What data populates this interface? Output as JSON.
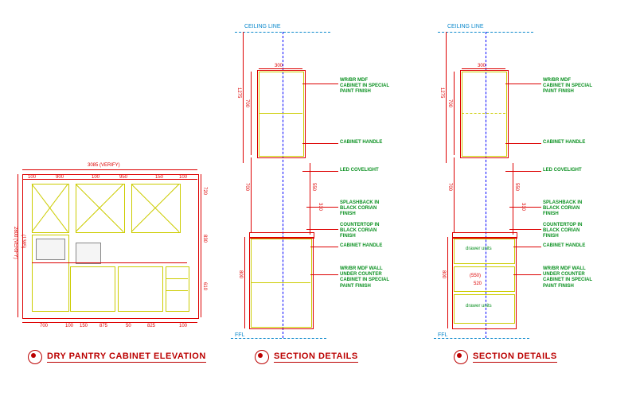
{
  "titles": {
    "elevation": "DRY PANTRY CABINET ELEVATION",
    "section1": "SECTION DETAILS",
    "section2": "SECTION DETAILS"
  },
  "ceiling_label": "CEILING LINE",
  "ffl_label": "FFL",
  "elevation": {
    "width_overall": "3085 (VERIFY)",
    "height_overall": "2800 (VERIFY)",
    "height_inner": "(1385)",
    "dims_top": [
      "100",
      "900",
      "100",
      "950",
      "150",
      "100"
    ],
    "dims_bot": [
      "700",
      "100",
      "150",
      "875",
      "50",
      "825",
      "100"
    ],
    "dim_side_top": "720",
    "dim_side_mid": "830",
    "dim_side_bot": "610"
  },
  "section": {
    "depth_top": "300",
    "upper_h": "700",
    "upper_total": "1275",
    "gap": "700",
    "counter_gap": "310",
    "splash_h": "550",
    "lower_h": "800",
    "drawer_depth": "(550)",
    "drawer_front": "520",
    "labels": {
      "upper_cab": "WR/BR MDF\nCABINET IN SPECIAL\nPAINT FINISH",
      "handle": "CABINET HANDLE",
      "led": "LED COVELIGHT",
      "splash": "SPLASHBACK IN\nBLACK CORIAN\nFINISH",
      "counter": "COUNTERTOP IN\nBLACK CORIAN\nFINISH",
      "handle2": "CABINET HANDLE",
      "lower_cab": "WR/BR MDF WALL\nUNDER COUNTER\nCABINET IN SPECIAL\nPAINT FINISH",
      "drawer": "drawer units"
    }
  }
}
